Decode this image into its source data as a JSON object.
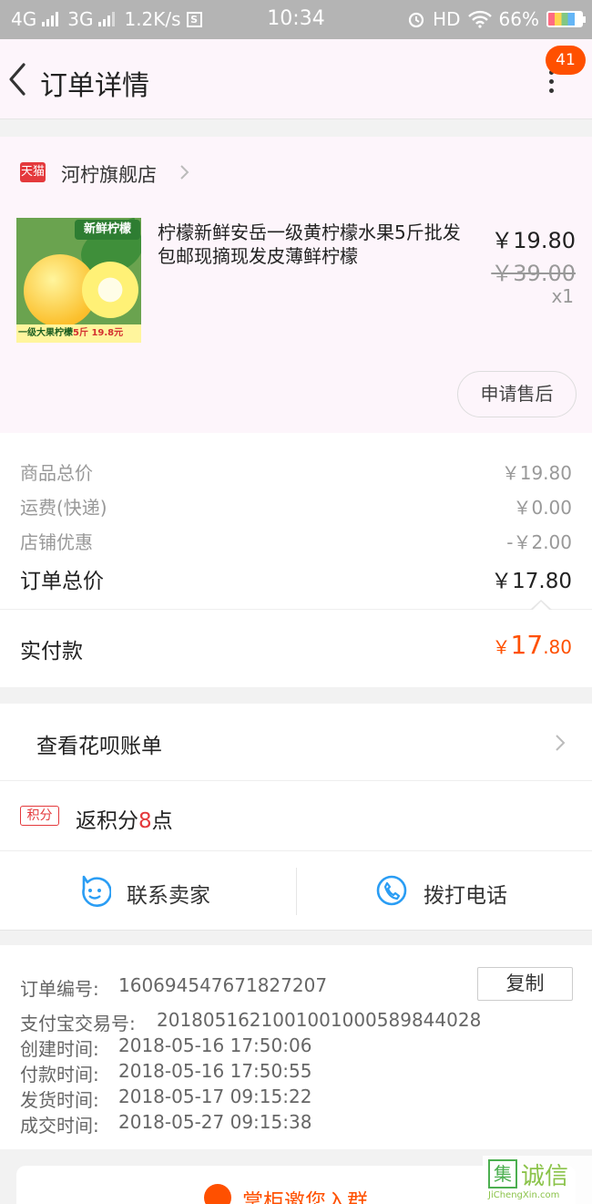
{
  "status_bar": {
    "network_1": "4G",
    "network_2": "3G",
    "speed": "1.2K/s",
    "sim_icon": "S",
    "time": "10:34",
    "hd": "HD",
    "battery": "66%"
  },
  "nav": {
    "title": "订单详情",
    "badge_count": "41"
  },
  "shop": {
    "badge": "天猫",
    "name": "河柠旗舰店"
  },
  "product": {
    "image_banner_top": "新鲜柠檬",
    "image_banner_bottom": "一级大果柠檬",
    "image_banner_weight": "5斤",
    "image_banner_price": "19.8元",
    "title": "柠檬新鲜安岳一级黄柠檬水果5斤批发包邮现摘现发皮薄鲜柠檬",
    "price": "￥19.80",
    "original_price": "￥39.00",
    "quantity": "x1",
    "after_sale_label": "申请售后"
  },
  "summary": {
    "goods_total_label": "商品总价",
    "goods_total_value": "￥19.80",
    "shipping_label": "运费(快递)",
    "shipping_value": "￥0.00",
    "discount_label": "店铺优惠",
    "discount_value": "-￥2.00",
    "order_total_label": "订单总价",
    "order_total_value": "￥17.80",
    "paid_label": "实付款",
    "paid_currency": "￥",
    "paid_integer": "17",
    "paid_decimal": ".80"
  },
  "huabei": {
    "label": "查看花呗账单"
  },
  "points": {
    "badge": "积分",
    "prefix": "返积分",
    "number": "8",
    "suffix": "点"
  },
  "contact": {
    "seller_label": "联系卖家",
    "phone_label": "拨打电话"
  },
  "order_info": {
    "copy_label": "复制",
    "rows": [
      {
        "label": "订单编号:",
        "value": "160694547671827207"
      },
      {
        "label": "支付宝交易号:",
        "value": "2018051621001001000589844028"
      },
      {
        "label": "创建时间:",
        "value": "2018-05-16 17:50:06"
      },
      {
        "label": "付款时间:",
        "value": "2018-05-16 17:50:55"
      },
      {
        "label": "发货时间:",
        "value": "2018-05-17 09:15:22"
      },
      {
        "label": "成交时间:",
        "value": "2018-05-27 09:15:38"
      }
    ]
  },
  "bottom_card": {
    "label": "掌柜邀您入群"
  },
  "watermark": {
    "logo_char": "集",
    "text": "诚信",
    "url": "JiChengXin.com"
  },
  "colors": {
    "accent_orange": "#ff5000",
    "tmall_red": "#e4393c",
    "icon_blue": "#2a9df4"
  }
}
